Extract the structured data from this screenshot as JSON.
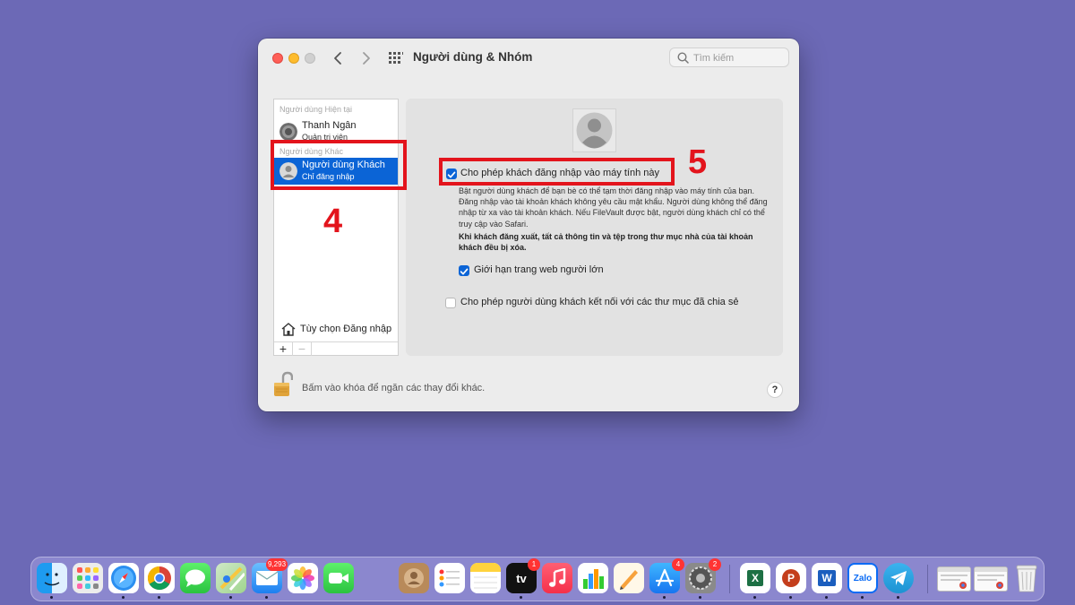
{
  "window": {
    "title": "Người dùng & Nhóm",
    "search_placeholder": "Tìm kiếm"
  },
  "sidebar": {
    "current_header": "Người dùng Hiện tại",
    "other_header": "Người dùng Khác",
    "users": [
      {
        "name": "Thanh Ngân",
        "role": "Quản trị viên"
      },
      {
        "name": "Người dùng Khách",
        "role": "Chỉ đăng nhập"
      }
    ],
    "login_options": "Tùy chọn Đăng nhập",
    "add_label": "+",
    "remove_label": "−"
  },
  "panel": {
    "allow_guest_login": {
      "label": "Cho phép khách đăng nhập vào máy tính này",
      "checked": true
    },
    "description": "Bật người dùng khách để bạn bè có thể tạm thời đăng nhập vào máy tính của bạn. Đăng nhập vào tài khoản khách không yêu cầu mật khẩu. Người dùng không thể đăng nhập từ xa vào tài khoản khách. Nếu FileVault được bật, người dùng khách chỉ có thể truy cập vào Safari.",
    "warning": "Khi khách đăng xuất, tất cả thông tin và tệp trong thư mục nhà của tài khoản khách đều bị xóa.",
    "limit_adult": {
      "label": "Giới hạn trang web người lớn",
      "checked": true
    },
    "shared_folders": {
      "label": "Cho phép người dùng khách kết nối với các thư mục đã chia sẻ",
      "checked": false
    }
  },
  "footer": {
    "lock_text": "Bấm vào khóa để ngăn các thay đổi khác.",
    "help_label": "?"
  },
  "annotations": {
    "step4": "4",
    "step5": "5",
    "color": "#e3141c"
  },
  "dock": {
    "badges": {
      "mail": "9,293",
      "tv": "1",
      "appstore": "4",
      "settings": "2"
    },
    "tv_label": "tv",
    "zalo_label": "Zalo",
    "excel_label": "X",
    "powerpoint_label": "P",
    "word_label": "W"
  }
}
